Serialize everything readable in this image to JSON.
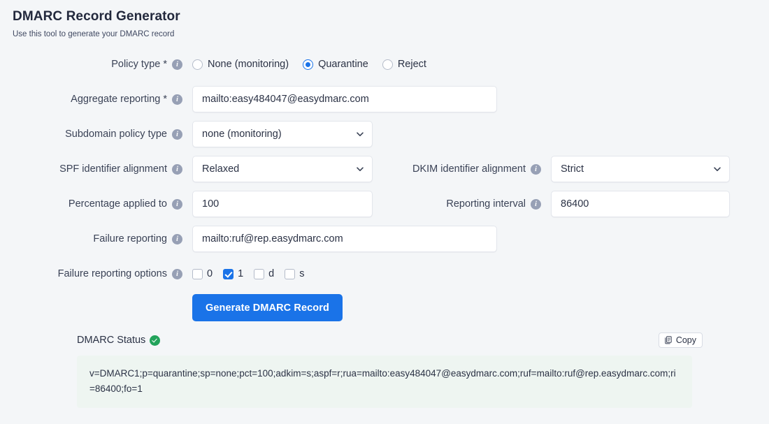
{
  "header": {
    "title": "DMARC Record Generator",
    "subtitle": "Use this tool to generate your DMARC record"
  },
  "form": {
    "policy_type": {
      "label": "Policy type *",
      "info_icon": "info-icon",
      "options": [
        {
          "label": "None (monitoring)",
          "checked": false
        },
        {
          "label": "Quarantine",
          "checked": true
        },
        {
          "label": "Reject",
          "checked": false
        }
      ]
    },
    "aggregate_reporting": {
      "label": "Aggregate reporting *",
      "info_icon": "info-icon",
      "value": "mailto:easy484047@easydmarc.com"
    },
    "subdomain_policy": {
      "label": "Subdomain policy type",
      "info_icon": "info-icon",
      "value": "none (monitoring)",
      "chevron_icon": "chevron-down-icon"
    },
    "spf_alignment": {
      "label": "SPF identifier alignment",
      "info_icon": "info-icon",
      "value": "Relaxed",
      "chevron_icon": "chevron-down-icon"
    },
    "dkim_alignment": {
      "label": "DKIM identifier alignment",
      "info_icon": "info-icon",
      "value": "Strict",
      "chevron_icon": "chevron-down-icon"
    },
    "percentage": {
      "label": "Percentage applied to",
      "info_icon": "info-icon",
      "value": "100"
    },
    "reporting_interval": {
      "label": "Reporting interval",
      "info_icon": "info-icon",
      "value": "86400"
    },
    "failure_reporting": {
      "label": "Failure reporting",
      "info_icon": "info-icon",
      "value": "mailto:ruf@rep.easydmarc.com"
    },
    "failure_options": {
      "label": "Failure reporting options",
      "info_icon": "info-icon",
      "options": [
        {
          "label": "0",
          "checked": false
        },
        {
          "label": "1",
          "checked": true
        },
        {
          "label": "d",
          "checked": false
        },
        {
          "label": "s",
          "checked": false
        }
      ]
    },
    "generate_button": {
      "label": "Generate DMARC Record",
      "color": "#1a73e8"
    }
  },
  "result": {
    "status_label": "DMARC Status",
    "status_icon": "check-circle-icon",
    "status_color": "#22a35b",
    "copy_button": {
      "label": "Copy",
      "icon": "copy-icon"
    },
    "record": "v=DMARC1;p=quarantine;sp=none;pct=100;adkim=s;aspf=r;rua=mailto:easy484047@easydmarc.com;ruf=mailto:ruf@rep.easydmarc.com;ri=86400;fo=1"
  }
}
